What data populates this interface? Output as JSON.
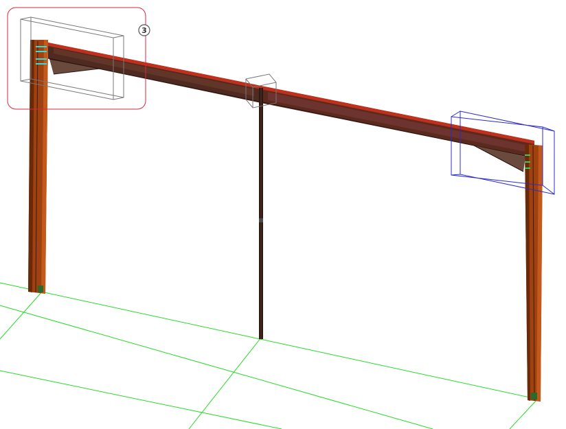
{
  "viewport": {
    "background": "#ffffff",
    "grid_color": "#22dd22",
    "member_color": "#a0420f",
    "member_dark": "#3a2218",
    "rafter_color": "#5a2a1e",
    "selection_color": "#2a2ad0",
    "highlight_color": "#d9263a",
    "bolt_color": "#33dddd"
  },
  "callout": {
    "label": "3"
  }
}
